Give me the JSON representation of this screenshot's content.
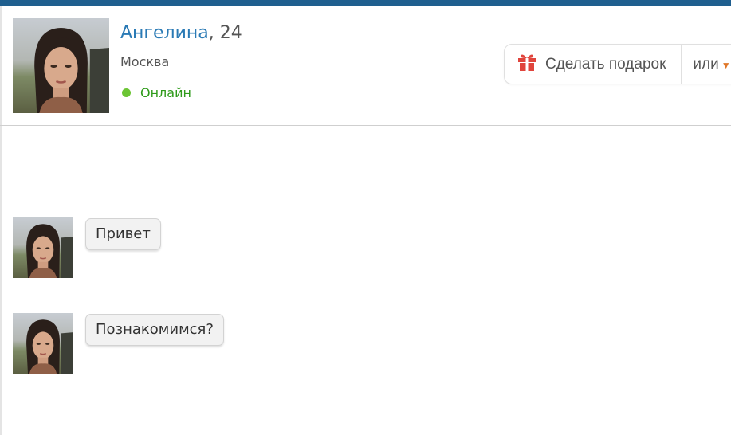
{
  "profile": {
    "name": "Ангелина",
    "age_suffix": ", 24",
    "city": "Москва",
    "status": "Онлайн"
  },
  "actions": {
    "gift_label": "Сделать подарок",
    "gift_icon": "gift-icon",
    "or_label": "или",
    "or_icon": "chevron-down-icon"
  },
  "messages": [
    {
      "text": "Привет"
    },
    {
      "text": "Познакомимся?"
    }
  ],
  "colors": {
    "topbar": "#1f5f8f",
    "name_link": "#2a7ab5",
    "online": "#2f9b1b",
    "gift_icon": "#e0443c"
  }
}
